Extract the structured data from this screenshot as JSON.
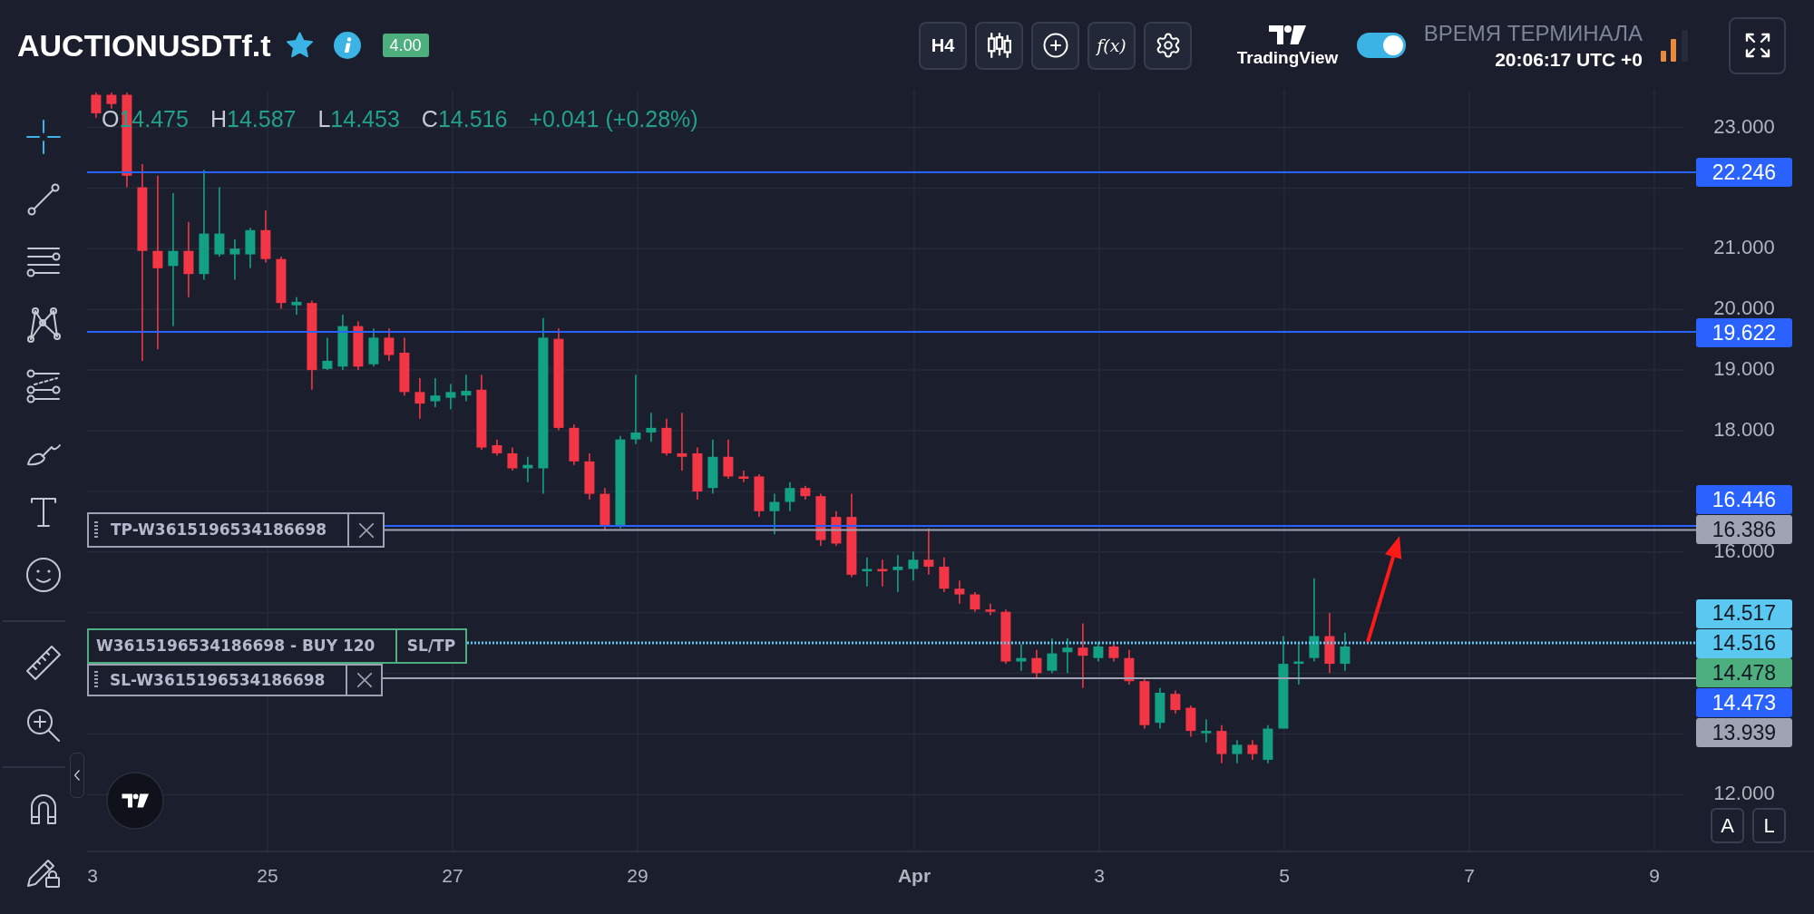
{
  "symbol": {
    "name": "AUCTIONUSDTf.t",
    "favorite": true,
    "badge": "4.00"
  },
  "toolbar": {
    "timeframe": "H4",
    "indicators": "f(x)"
  },
  "brand": {
    "name": "TradingView"
  },
  "chart_switch": {
    "on": true
  },
  "terminal_time": {
    "label": "ВРЕМЯ ТЕРМИНАЛА",
    "value": "20:06:17 UTC +0"
  },
  "drawing_tools": [
    {
      "selected": true
    },
    {
      "selected": false
    },
    {
      "selected": false
    },
    {
      "selected": false
    },
    {
      "selected": false
    },
    {
      "selected": false
    },
    {
      "selected": false
    },
    {
      "selected": false
    }
  ],
  "measure_tools": [
    {
      "selected": false
    },
    {
      "selected": false
    }
  ],
  "mode_tools": [
    {
      "selected": false
    },
    {
      "selected": false
    }
  ],
  "legend": {
    "items": [
      {
        "label": "O",
        "value": "14.475"
      },
      {
        "label": "H",
        "value": "14.587"
      },
      {
        "label": "L",
        "value": "14.453"
      },
      {
        "label": "C",
        "value": "14.516"
      }
    ],
    "change": "+0.041 (+0.28%)"
  },
  "orders": [
    {
      "kind": "take_profit",
      "label": "TP-W3615196534186698"
    },
    {
      "kind": "position",
      "label": "W3615196534186698 - BUY 120",
      "action": "SL/TP"
    },
    {
      "kind": "stop_loss",
      "label": "SL-W3615196534186698"
    }
  ],
  "price_axis": {
    "ticks": [
      "23.000",
      "21.000",
      "20.000",
      "19.000",
      "18.000",
      "16.000",
      "12.000"
    ],
    "labels": [
      {
        "value": "22.246",
        "color": "#2962ff"
      },
      {
        "value": "19.622",
        "color": "#2962ff"
      },
      {
        "value": "16.446",
        "color": "#2962ff"
      },
      {
        "value": "16.386",
        "color": "#a0a3b3"
      },
      {
        "value": "14.517",
        "color": "#5ac8f0"
      },
      {
        "value": "14.516",
        "color": "#5ac8f0"
      },
      {
        "value": "14.478",
        "color": "#4caf7d"
      },
      {
        "value": "14.473",
        "color": "#2962ff"
      },
      {
        "value": "13.939",
        "color": "#a0a3b3"
      }
    ]
  },
  "scale_buttons": [
    {
      "label": "A"
    },
    {
      "label": "L"
    }
  ],
  "time_axis": [
    {
      "label": "3",
      "kind": "day"
    },
    {
      "label": "25",
      "kind": "day"
    },
    {
      "label": "27",
      "kind": "day"
    },
    {
      "label": "29",
      "kind": "day"
    },
    {
      "label": "Apr",
      "kind": "month"
    },
    {
      "label": "3",
      "kind": "day"
    },
    {
      "label": "5",
      "kind": "day"
    },
    {
      "label": "7",
      "kind": "day"
    },
    {
      "label": "9",
      "kind": "day"
    }
  ]
}
